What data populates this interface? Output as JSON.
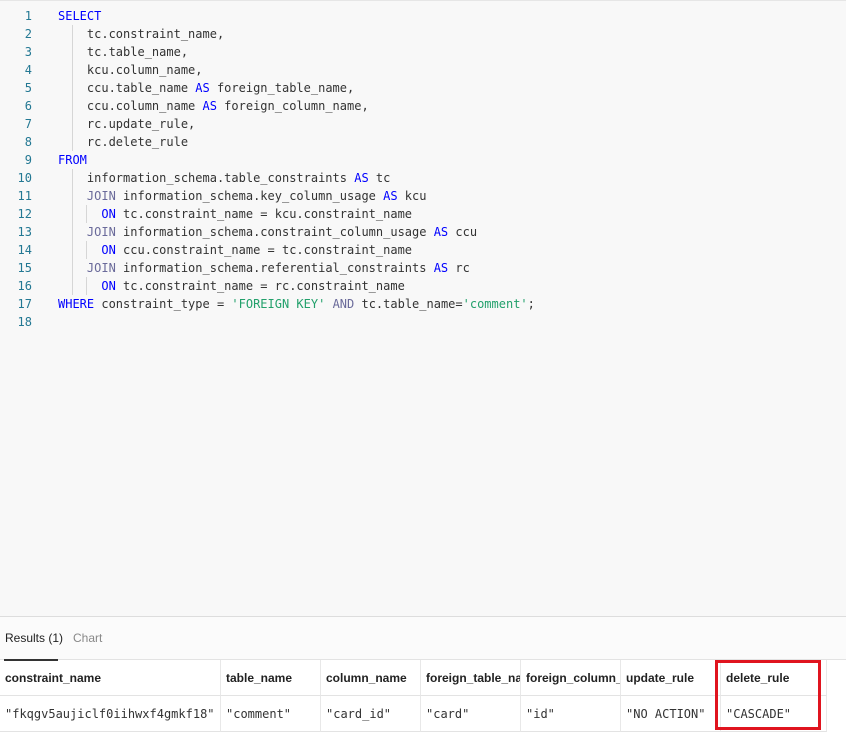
{
  "editor": {
    "lines": [
      {
        "num": "1",
        "tokens": [
          {
            "t": "SELECT",
            "c": "kw"
          }
        ]
      },
      {
        "num": "2",
        "tokens": [
          {
            "t": "    tc.constraint_name,",
            "c": ""
          }
        ]
      },
      {
        "num": "3",
        "tokens": [
          {
            "t": "    tc.table_name,",
            "c": ""
          }
        ]
      },
      {
        "num": "4",
        "tokens": [
          {
            "t": "    kcu.column_name,",
            "c": ""
          }
        ]
      },
      {
        "num": "5",
        "tokens": [
          {
            "t": "    ccu.table_name ",
            "c": ""
          },
          {
            "t": "AS",
            "c": "kw"
          },
          {
            "t": " foreign_table_name,",
            "c": ""
          }
        ]
      },
      {
        "num": "6",
        "tokens": [
          {
            "t": "    ccu.column_name ",
            "c": ""
          },
          {
            "t": "AS",
            "c": "kw"
          },
          {
            "t": " foreign_column_name,",
            "c": ""
          }
        ]
      },
      {
        "num": "7",
        "tokens": [
          {
            "t": "    rc.update_rule,",
            "c": ""
          }
        ]
      },
      {
        "num": "8",
        "tokens": [
          {
            "t": "    rc.delete_rule",
            "c": ""
          }
        ]
      },
      {
        "num": "9",
        "tokens": [
          {
            "t": "FROM",
            "c": "kw"
          }
        ]
      },
      {
        "num": "10",
        "tokens": [
          {
            "t": "    information_schema.table_constraints ",
            "c": ""
          },
          {
            "t": "AS",
            "c": "kw"
          },
          {
            "t": " tc",
            "c": ""
          }
        ]
      },
      {
        "num": "11",
        "tokens": [
          {
            "t": "    ",
            "c": ""
          },
          {
            "t": "JOIN",
            "c": "op"
          },
          {
            "t": " information_schema.key_column_usage ",
            "c": ""
          },
          {
            "t": "AS",
            "c": "kw"
          },
          {
            "t": " kcu",
            "c": ""
          }
        ]
      },
      {
        "num": "12",
        "tokens": [
          {
            "t": "      ",
            "c": ""
          },
          {
            "t": "ON",
            "c": "kw"
          },
          {
            "t": " tc.constraint_name = kcu.constraint_name",
            "c": ""
          }
        ]
      },
      {
        "num": "13",
        "tokens": [
          {
            "t": "    ",
            "c": ""
          },
          {
            "t": "JOIN",
            "c": "op"
          },
          {
            "t": " information_schema.constraint_column_usage ",
            "c": ""
          },
          {
            "t": "AS",
            "c": "kw"
          },
          {
            "t": " ccu",
            "c": ""
          }
        ]
      },
      {
        "num": "14",
        "tokens": [
          {
            "t": "      ",
            "c": ""
          },
          {
            "t": "ON",
            "c": "kw"
          },
          {
            "t": " ccu.constraint_name = tc.constraint_name",
            "c": ""
          }
        ]
      },
      {
        "num": "15",
        "tokens": [
          {
            "t": "    ",
            "c": ""
          },
          {
            "t": "JOIN",
            "c": "op"
          },
          {
            "t": " information_schema.referential_constraints ",
            "c": ""
          },
          {
            "t": "AS",
            "c": "kw"
          },
          {
            "t": " rc",
            "c": ""
          }
        ]
      },
      {
        "num": "16",
        "tokens": [
          {
            "t": "      ",
            "c": ""
          },
          {
            "t": "ON",
            "c": "kw"
          },
          {
            "t": " tc.constraint_name = rc.constraint_name",
            "c": ""
          }
        ]
      },
      {
        "num": "17",
        "tokens": [
          {
            "t": "WHERE",
            "c": "kw"
          },
          {
            "t": " constraint_type = ",
            "c": ""
          },
          {
            "t": "'FOREIGN KEY'",
            "c": "str"
          },
          {
            "t": " ",
            "c": ""
          },
          {
            "t": "AND",
            "c": "op"
          },
          {
            "t": " tc.table_name=",
            "c": ""
          },
          {
            "t": "'comment'",
            "c": "str"
          },
          {
            "t": ";",
            "c": ""
          }
        ]
      },
      {
        "num": "18",
        "tokens": []
      }
    ]
  },
  "tabs": {
    "results_label": "Results (1)",
    "chart_label": "Chart"
  },
  "results": {
    "columns": [
      "constraint_name",
      "table_name",
      "column_name",
      "foreign_table_name",
      "foreign_column_name",
      "update_rule",
      "delete_rule"
    ],
    "rows": [
      [
        "\"fkqgv5aujiclf0iihwxf4gmkf18\"",
        "\"comment\"",
        "\"card_id\"",
        "\"card\"",
        "\"id\"",
        "\"NO ACTION\"",
        "\"CASCADE\""
      ]
    ]
  },
  "colors": {
    "keyword": "#0000ff",
    "string": "#22a06b",
    "highlight": "#e0141f"
  }
}
